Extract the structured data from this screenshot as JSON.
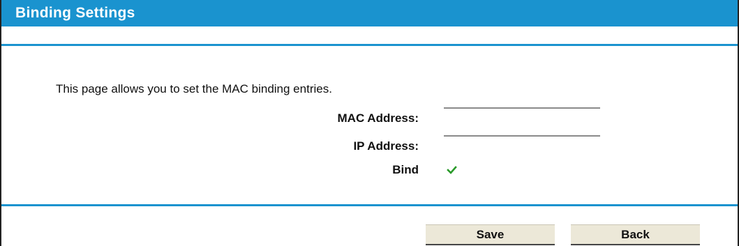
{
  "title": "Binding Settings",
  "description": "This page allows you to set the MAC binding entries.",
  "form": {
    "mac_label": "MAC Address:",
    "mac_value": "",
    "ip_label": "IP Address:",
    "ip_value": "",
    "bind_label": "Bind",
    "bind_checked": true
  },
  "buttons": {
    "save_label": "Save",
    "back_label": "Back"
  },
  "colors": {
    "accent": "#1a93cf",
    "check": "#2a9a2a",
    "button_bg": "#ece8d8"
  },
  "icons": {
    "bind_check": "checkmark-icon"
  }
}
